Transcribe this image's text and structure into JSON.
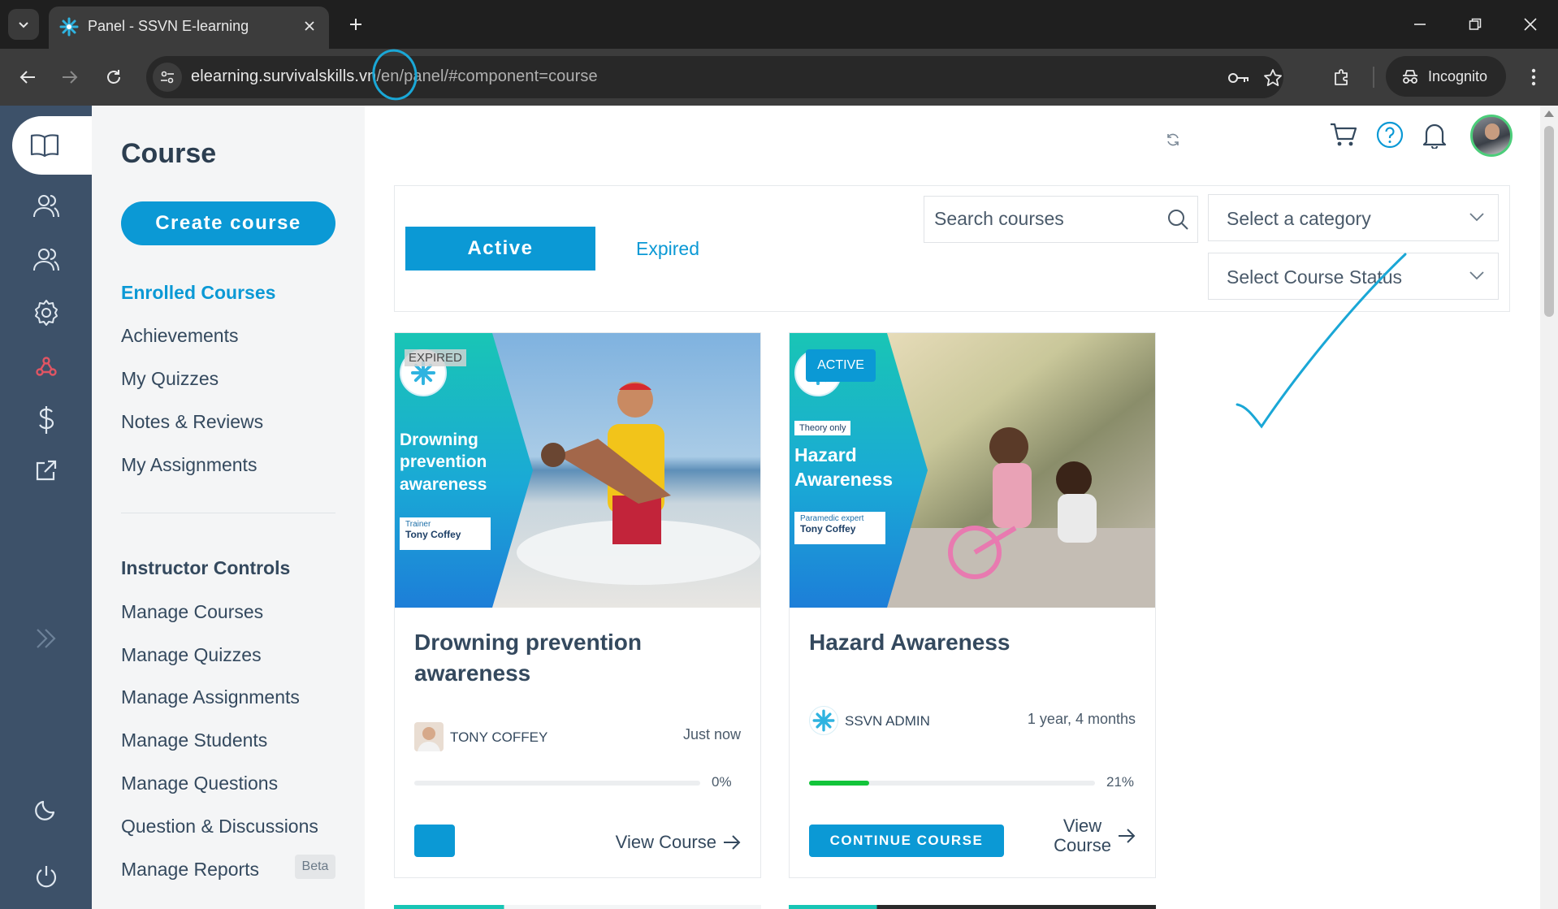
{
  "browser": {
    "tab_title": "Panel - SSVN E-learning",
    "url_host": "elearning.survivalskills.vn",
    "url_path": "/en/panel/#component=course",
    "incognito_label": "Incognito"
  },
  "sidemenu": {
    "title": "Course",
    "create_button": "Create course",
    "links": [
      "Enrolled Courses",
      "Achievements",
      "My Quizzes",
      "Notes & Reviews",
      "My Assignments"
    ],
    "instructor_heading": "Instructor Controls",
    "instructor_links": [
      "Manage Courses",
      "Manage Quizzes",
      "Manage Assignments",
      "Manage Students",
      "Manage Questions",
      "Question & Discussions",
      "Manage Reports"
    ],
    "beta_badge": "Beta"
  },
  "filters": {
    "tab_active": "Active",
    "tab_expired": "Expired",
    "search_placeholder": "Search courses",
    "category_placeholder": "Select a category",
    "status_placeholder": "Select Course Status"
  },
  "courses": [
    {
      "badge": "EXPIRED",
      "thumb_title": "Drowning prevention awareness",
      "thumb_role": "Trainer",
      "thumb_name": "Tony Coffey",
      "title": "Drowning prevention awareness",
      "author": "TONY COFFEY",
      "time": "Just now",
      "progress": 0,
      "progress_label": "0%",
      "view_label": "View Course"
    },
    {
      "badge": "ACTIVE",
      "thumb_small": "Theory only",
      "thumb_title": "Hazard Awareness",
      "thumb_role": "Paramedic expert",
      "thumb_name": "Tony Coffey",
      "title": "Hazard Awareness",
      "author": "SSVN ADMIN",
      "time": "1 year, 4 months",
      "progress": 21,
      "progress_label": "21%",
      "continue_label": "CONTINUE COURSE",
      "view_label_1": "View",
      "view_label_2": "Course"
    }
  ],
  "colors": {
    "accent": "#0b99d5",
    "rail": "#3d5169",
    "progress": "#12c43a"
  }
}
